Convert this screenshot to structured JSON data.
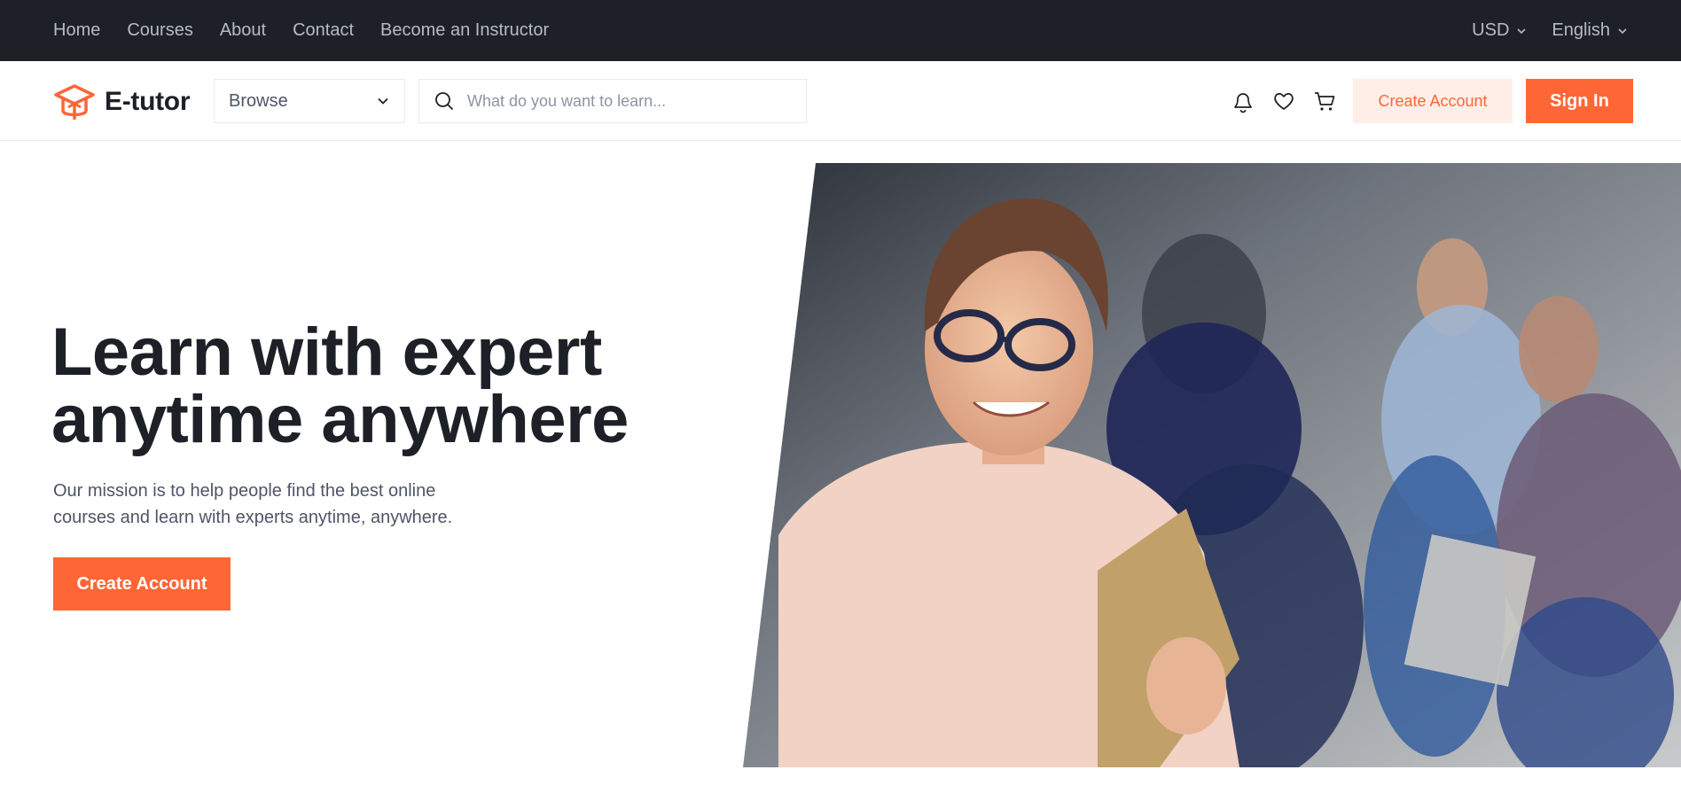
{
  "topbar": {
    "nav": [
      {
        "label": "Home"
      },
      {
        "label": "Courses"
      },
      {
        "label": "About"
      },
      {
        "label": "Contact"
      },
      {
        "label": "Become an Instructor"
      }
    ],
    "currency": "USD",
    "language": "English"
  },
  "header": {
    "logo_text": "E-tutor",
    "browse_label": "Browse",
    "search_placeholder": "What do you want to learn...",
    "create_account_label": "Create Account",
    "sign_in_label": "Sign In",
    "icons": [
      "bell-icon",
      "heart-icon",
      "cart-icon"
    ]
  },
  "hero": {
    "title_line1": "Learn with expert",
    "title_line2": "anytime anywhere",
    "description": "Our mission is to help people find the best online courses and learn with experts anytime, anywhere.",
    "cta_label": "Create Account"
  },
  "colors": {
    "brand": "#ff6636",
    "brand_light": "#ffeee8",
    "topbar_bg": "#1d2026",
    "text_dark": "#1d2026",
    "text_muted": "#4e5566"
  }
}
